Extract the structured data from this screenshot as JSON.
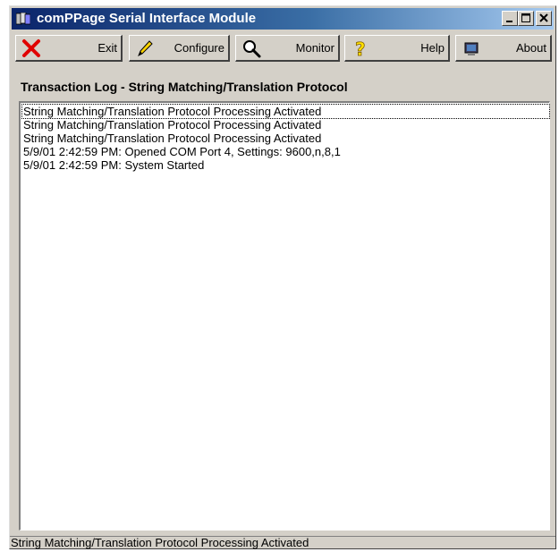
{
  "window": {
    "title": "comPPage Serial Interface Module"
  },
  "toolbar": {
    "exit_label": "Exit",
    "configure_label": "Configure",
    "monitor_label": "Monitor",
    "help_label": "Help",
    "about_label": "About"
  },
  "section": {
    "title": "Transaction Log - String Matching/Translation Protocol"
  },
  "log": {
    "lines": [
      "String Matching/Translation Protocol Processing Activated",
      "String Matching/Translation Protocol Processing Activated",
      "String Matching/Translation Protocol Processing Activated",
      "5/9/01 2:42:59 PM: Opened COM Port 4, Settings: 9600,n,8,1",
      "5/9/01 2:42:59 PM: System Started"
    ]
  },
  "status": {
    "text": "String Matching/Translation Protocol Processing Activated"
  },
  "icons": {
    "app": "app-window-icon",
    "exit": "red-x-icon",
    "configure": "pencil-icon",
    "monitor": "magnifier-icon",
    "help": "question-mark-icon",
    "about": "about-monitor-icon"
  }
}
